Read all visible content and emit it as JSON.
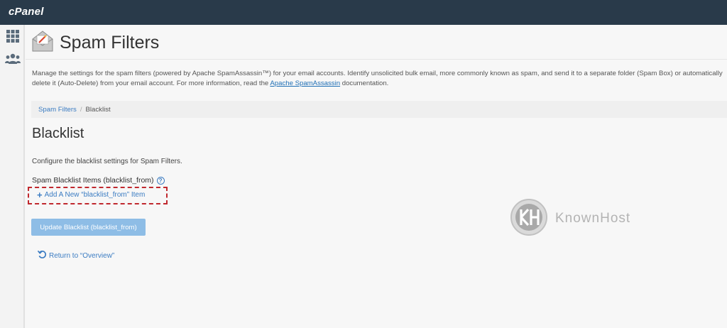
{
  "app": {
    "logo": "cPanel"
  },
  "nav": {
    "icons": [
      "grid-icon",
      "users-icon"
    ]
  },
  "header": {
    "title": "Spam Filters"
  },
  "description": {
    "text_before_link": "Manage the settings for the spam filters (powered by Apache SpamAssassin™) for your email accounts. Identify unsolicited bulk email, more commonly known as spam, and send it to a separate folder (Spam Box) or automatically delete it (Auto-Delete) from your email account. For more information, read the ",
    "link": "Apache SpamAssassin",
    "text_after_link": " documentation."
  },
  "breadcrumb": {
    "parent": "Spam Filters",
    "separator": "/",
    "current": "Blacklist"
  },
  "section": {
    "title": "Blacklist",
    "intro": "Configure the blacklist settings for Spam Filters.",
    "items_label": "Spam Blacklist Items (blacklist_from)",
    "help": "?",
    "add_plus": "+",
    "add_item_label": "Add A New “blacklist_from” Item",
    "update_button": "Update Blacklist (blacklist_from)",
    "return_link": "Return to “Overview”"
  },
  "watermark": {
    "brand": "KnownHost"
  },
  "colors": {
    "topbar": "#293a4a",
    "link": "#3b7cc2",
    "button": "#8ebde6",
    "highlight": "#c0282e"
  }
}
